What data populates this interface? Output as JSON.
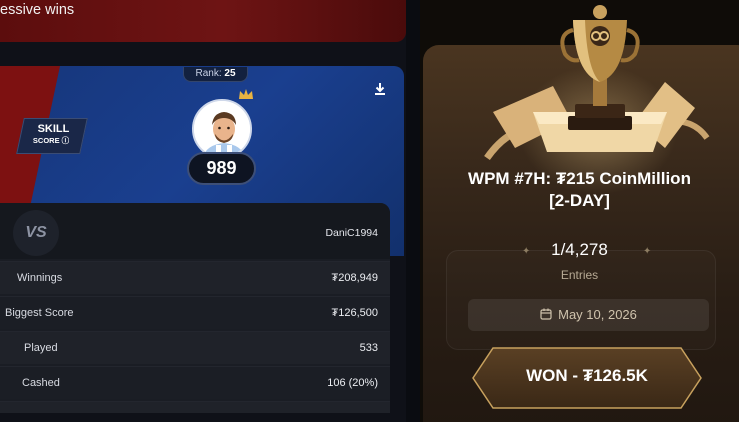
{
  "banner": {
    "text": "essive wins"
  },
  "profile": {
    "rank_label": "Rank:",
    "rank_value": "25",
    "skill_label": "SKILL",
    "skill_sub": "SCORE ⓘ",
    "score": "989"
  },
  "stats": {
    "vs_label": "VS",
    "opponent": "DaniC1994",
    "rows": [
      {
        "label": "Winnings",
        "value": "₮208,949"
      },
      {
        "label": "Biggest Score",
        "value": "₮126,500"
      },
      {
        "label": "Played",
        "value": "533"
      },
      {
        "label": "Cashed",
        "value": "106 (20%)"
      }
    ]
  },
  "tournament": {
    "title_line1": "WPM #7H: ₮215 CoinMillion",
    "title_line2": "[2-DAY]",
    "entries_value": "1/4,278",
    "entries_label": "Entries",
    "date": "May 10, 2026",
    "won_text": "WON - ₮126.5K"
  },
  "colors": {
    "profile_blue": "#1a3f8f",
    "accent_red": "#7d1111",
    "card_brown": "#4a3520",
    "gold": "#c8a15e"
  },
  "icons": [
    "download-icon",
    "crown-icon",
    "info-icon",
    "calendar-icon",
    "trophy-icon",
    "sparkle-icon"
  ]
}
